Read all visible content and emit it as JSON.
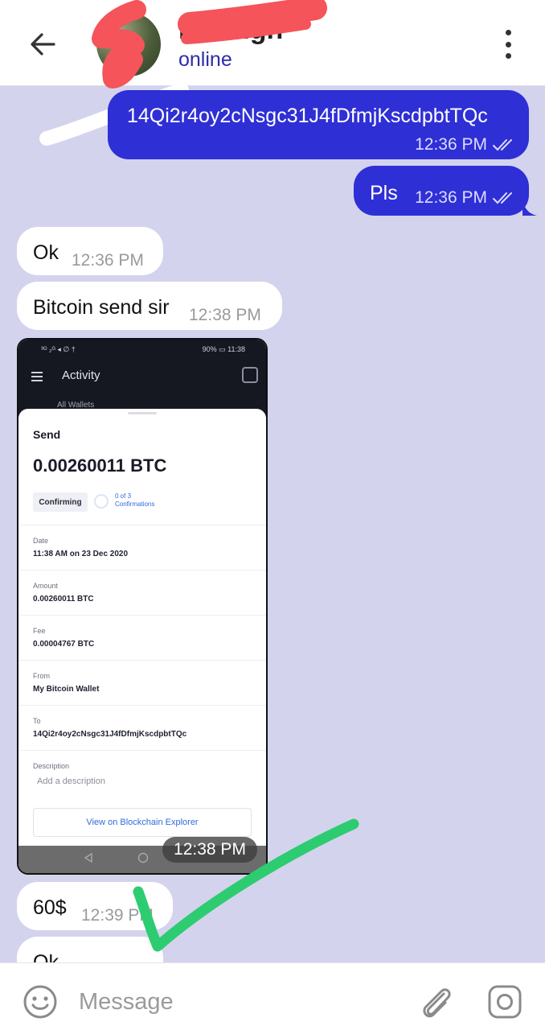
{
  "header": {
    "contact_name": "D Bingh",
    "status": "online",
    "back_icon": "arrow-left-icon",
    "menu_icon": "more-vert-icon"
  },
  "messages": [
    {
      "direction": "out",
      "text": "14Qi2r4oy2cNsgc31J4fDfmjKscdpbtTQc",
      "time": "12:36 PM"
    },
    {
      "direction": "out",
      "text": "Pls",
      "time": "12:36 PM"
    },
    {
      "direction": "in",
      "text": "Ok",
      "time": "12:36 PM"
    },
    {
      "direction": "in",
      "text": "Bitcoin send sir",
      "time": "12:38 PM"
    },
    {
      "direction": "in",
      "text": "60$",
      "time": "12:39 PM"
    },
    {
      "direction": "in",
      "text": "Ok",
      "time": ""
    }
  ],
  "image_message": {
    "time": "12:38 PM",
    "screenshot": {
      "status_left": "³ᴳ ₂ᴳ ◂ ∅ †",
      "status_right": "90% ▭ 11:38",
      "screen_title": "Activity",
      "wallet_filter": "All Wallets",
      "sheet_title": "Send",
      "amount": "0.00260011 BTC",
      "status_chip": "Confirming",
      "confirmations_line1": "0 of 3",
      "confirmations_line2": "Confirmations",
      "rows": [
        {
          "label": "Date",
          "value": "11:38 AM on 23 Dec 2020"
        },
        {
          "label": "Amount",
          "value": "0.00260011 BTC"
        },
        {
          "label": "Fee",
          "value": "0.00004767 BTC"
        },
        {
          "label": "From",
          "value": "My Bitcoin Wallet"
        },
        {
          "label": "To",
          "value": "14Qi2r4oy2cNsgc31J4fDfmjKscdpbtTQc"
        }
      ],
      "description_label": "Description",
      "description_placeholder": "Add a description",
      "explorer_button": "View on Blockchain Explorer"
    }
  },
  "composer": {
    "placeholder": "Message",
    "emoji_icon": "smiley-icon",
    "attach_icon": "paperclip-icon",
    "camera_icon": "instagram-camera-icon"
  },
  "colors": {
    "background": "#d4d3ee",
    "outgoing_bubble": "#2f2fd6",
    "incoming_bubble": "#ffffff",
    "status_text": "#2c2ca8",
    "redaction": "#f4545a",
    "checkmark": "#2ecc71"
  }
}
